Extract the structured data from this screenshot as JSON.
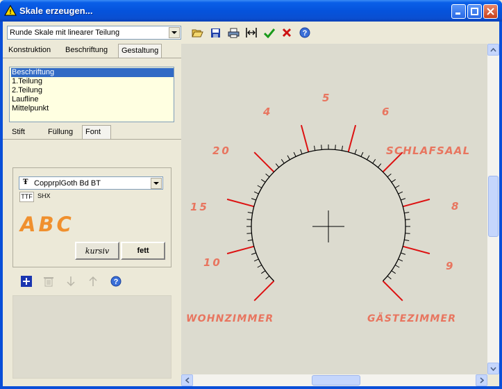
{
  "window": {
    "title": "Skale erzeugen..."
  },
  "toolbar": {
    "scale_type": "Runde Skale mit linearer Teilung",
    "icons": [
      "folder-open-icon",
      "save-icon",
      "print-icon",
      "mirror-icon",
      "ok-check-icon",
      "cancel-x-icon",
      "help-icon"
    ]
  },
  "tabs": {
    "main": [
      "Konstruktion",
      "Beschriftung",
      "Gestaltung"
    ],
    "sub": [
      "Stift",
      "Füllung",
      "Font"
    ]
  },
  "elements_list": [
    "Beschriftung",
    "1.Teilung",
    "2.Teilung",
    "Laufline",
    "Mittelpunkt"
  ],
  "font": {
    "selected": "CopprplGoth Bd BT",
    "ttf_label": "TTF",
    "shx_label": "SHX",
    "preview": "ABC",
    "italic_label": "kursiv",
    "bold_label": "fett"
  },
  "list_tools": [
    "add-icon",
    "delete-icon",
    "move-down-icon",
    "move-up-icon",
    "help-icon"
  ],
  "dial": {
    "labels": [
      "10",
      "15",
      "20",
      "4",
      "5",
      "6",
      "SCHLAFSAAL",
      "8",
      "9"
    ],
    "left_caption": "WOHNZIMMER",
    "right_caption": "GÄSTEZIMMER",
    "label_color": "#e8755f",
    "major_tick_color": "#dd1111"
  },
  "colors": {
    "accent": "#316ac5",
    "title_bar": "#0a4fd8"
  }
}
